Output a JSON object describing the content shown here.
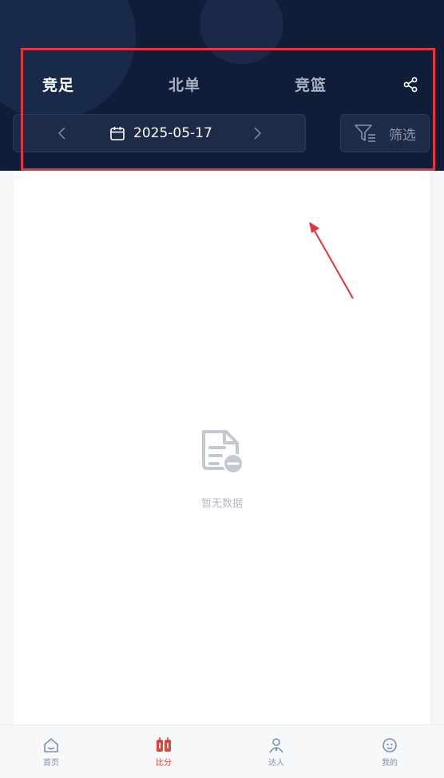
{
  "header": {
    "tabs": [
      {
        "label": "竞足",
        "active": true
      },
      {
        "label": "北单",
        "active": false
      },
      {
        "label": "竞篮",
        "active": false
      }
    ],
    "share_icon": "share-icon",
    "date": "2025-05-17",
    "filter_label": "筛选"
  },
  "content": {
    "empty_text": "暂无数据",
    "empty_icon": "no-data-document-icon"
  },
  "tabbar": {
    "items": [
      {
        "label": "首页",
        "icon": "home-icon",
        "active": false
      },
      {
        "label": "比分",
        "icon": "score-icon",
        "active": true
      },
      {
        "label": "达人",
        "icon": "expert-icon",
        "active": false
      },
      {
        "label": "我的",
        "icon": "profile-icon",
        "active": false
      }
    ]
  },
  "colors": {
    "header_bg": "#0f1d38",
    "accent_red": "#e1443a",
    "annotation_red": "#e5343d",
    "tab_inactive": "#a9b0bf"
  }
}
